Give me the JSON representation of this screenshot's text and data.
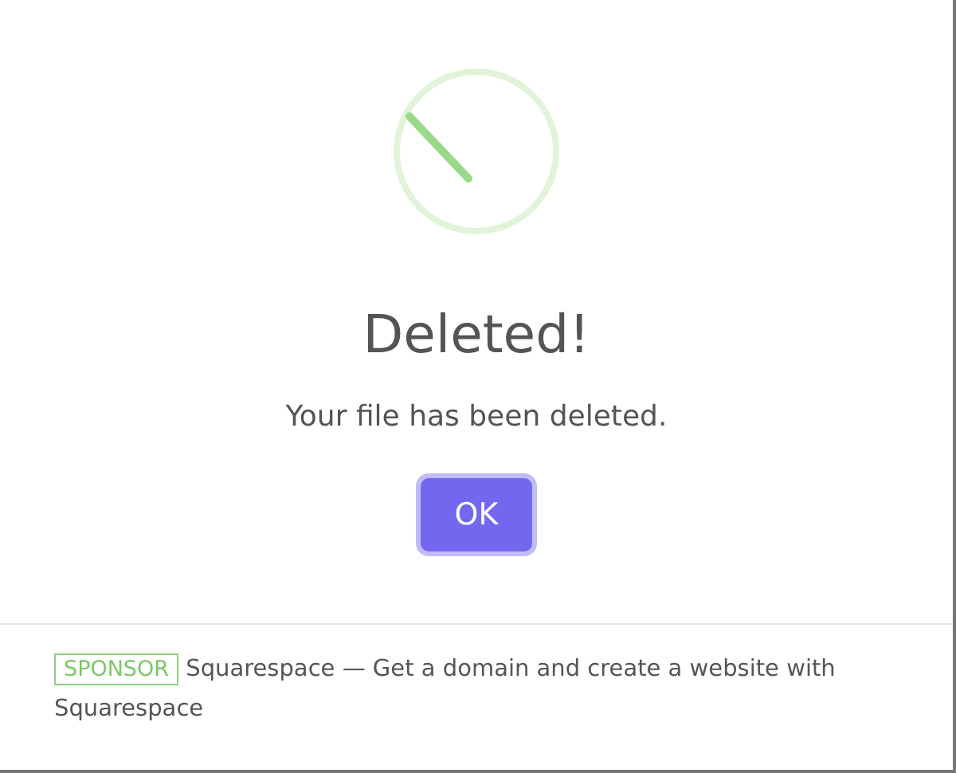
{
  "dialog": {
    "icon": {
      "kind": "success"
    },
    "title": "Deleted!",
    "message": "Your file has been deleted.",
    "buttons": [
      {
        "label": "OK",
        "focused": true
      }
    ],
    "footer": {
      "badge": "SPONSOR",
      "text": "Squarespace — Get a domain and create a website with Squarespace"
    }
  }
}
